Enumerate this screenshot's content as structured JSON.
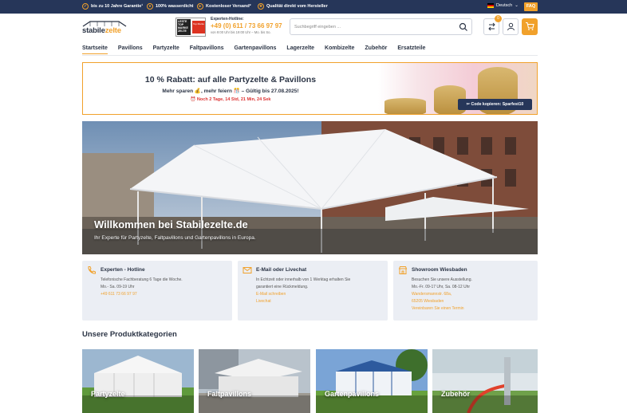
{
  "topbar": {
    "usps": [
      "bis zu 10 Jahre Garantie¹",
      "100% wasserdicht",
      "Kostenloser Versand²",
      "Qualität direkt vom Hersteller"
    ],
    "language": "Deutsch",
    "faq": "FAQ"
  },
  "header": {
    "logo_main": "stabile",
    "logo_accent": "zelte",
    "badge_line1": "LESTE",
    "badge_line2": "TOP MARKE",
    "badge_line3": "ZELTE",
    "badge_seal": "Top Marke",
    "hotline_label": "Experten-Hotline:",
    "hotline_number": "+49 (0) 611 / 73 66 97 97",
    "hotline_hours": "von 9:00 Uhr bis 19:00 Uhr – Mo. bis So.",
    "search_placeholder": "Suchbegriff eingeben ...",
    "compare_count": "0"
  },
  "nav": [
    "Startseite",
    "Pavillons",
    "Partyzelte",
    "Faltpavillons",
    "Gartenpavillons",
    "Lagerzelte",
    "Kombizelte",
    "Zubehör",
    "Ersatzteile"
  ],
  "promo": {
    "title": "10 % Rabatt: auf alle Partyzelte & Pavillons",
    "subtitle": "Mehr sparen 💰, mehr feiern 🎊 – Gültig bis 27.08.2025!",
    "countdown": "⏰ Noch 2 Tage, 14 Std, 21 Min, 24 Sek",
    "code_button": "✂ Code kopieren: Sparfest10"
  },
  "hero": {
    "title": "Willkommen bei Stabilezelte.de",
    "subtitle": "Ihr Experte für Partyzelte, Faltpavillons und Gartenpavillons in Europa."
  },
  "contact_cards": [
    {
      "title": "Experten - Hotline",
      "lines": [
        "Telefonische Fachberatung 6 Tage die Woche.",
        "Mo.- Sa. 09-19 Uhr"
      ],
      "links": [
        "+49 611 73 66 97 97"
      ]
    },
    {
      "title": "E-Mail oder Livechat",
      "lines": [
        "In Echtzeit oder innerhalb von 1 Werktag erhalten Sie",
        "garantiert eine Rückmeldung."
      ],
      "links": [
        "E-Mail schreiben",
        "Livechat"
      ]
    },
    {
      "title": "Showroom Wiesbaden",
      "lines": [
        "Besuchen Sie unsere Ausstellung.",
        "Mo.-Fr. 09-17 Uhr, Sa. 08-12 Uhr"
      ],
      "links": [
        "Wandersmannstr. 68a,",
        "65205 Wiesbaden",
        "Vereinbaren Sie einen Termin"
      ]
    }
  ],
  "categories_title": "Unsere Produktkategorien",
  "categories": [
    "Partyzelte",
    "Faltpavillons",
    "Gartenpavillons",
    "Zubehör"
  ],
  "colors": {
    "navy": "#263659",
    "accent": "#f1a12b",
    "card_bg": "#ebeef4",
    "countdown": "#d33"
  }
}
